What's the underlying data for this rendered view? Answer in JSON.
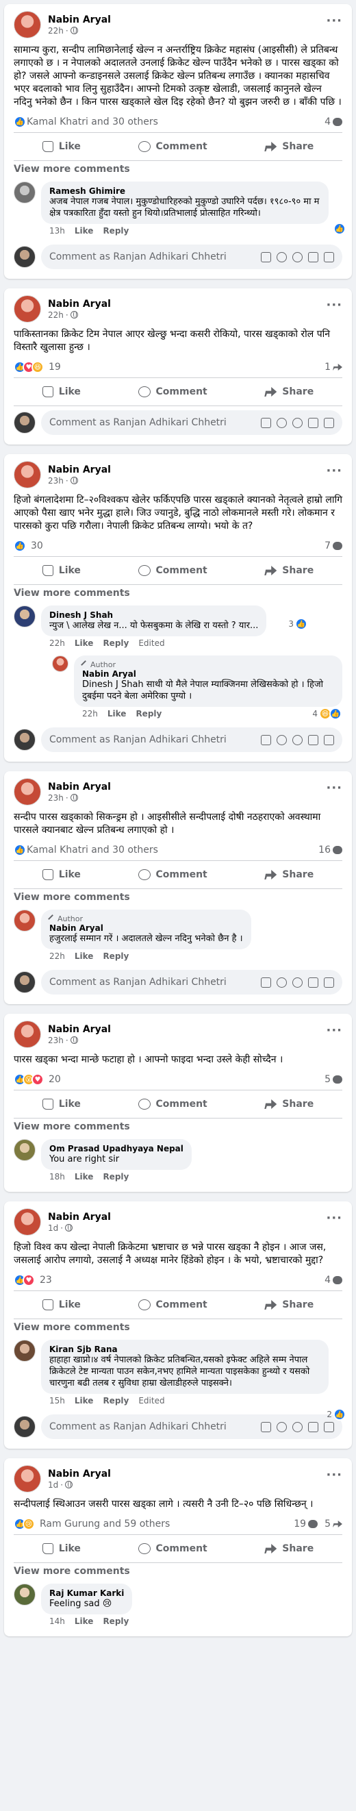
{
  "composer_placeholder": "Comment as Ranjan Adhikari Chhetri",
  "view_more": "View more comments",
  "actions": {
    "like": "Like",
    "comment": "Comment",
    "share": "Share"
  },
  "comment_actions": {
    "like": "Like",
    "reply": "Reply",
    "edited": "Edited"
  },
  "author_label": "Author",
  "posts": [
    {
      "author": "Nabin Aryal",
      "time": "22h",
      "text": "सामान्य कुरा, सन्दीप लामिछानेलाई खेल्न न अन्तर्राष्ट्रिय क्रिकेट महासंघ (आइसीसी) ले प्रतिबन्ध लगाएको छ । न नेपालको अदालतले उनलाई क्रिकेट खेल्न पाउँदैन भनेको छ । पारस खड्का को हो? जसले आफ्नो कन्डाइनसले उसलाई क्रिकेट खेल्न प्रतिबन्ध लगाउँछ । क्यानका महासचिव भएर बदलाको भाव लिनु सुहाउँदैन। आफ्नो टिमको उत्कृष्ट खेलाडी, जसलाई कानुनले खेल्न नदिनु भनेको छैन । किन पारस खड्काले खेल दिइ रहेको छैन? यो बुझन जरुरी छ । बाँकी पछि ।",
      "reactions_text": "Kamal Khatri and 30 others",
      "comments_count": "4",
      "shares_count": "",
      "comments": [
        {
          "name": "Ramesh Ghimire",
          "text": "अजब नेपाल गजब नेपाल। मुकुण्डोधारिहरुको मुकुण्डो उघारिने पर्दछ। १९८०-९० मा म क्षेत्र पत्रकारिता हुँदा यस्तो हुन थियो।प्रतिभालाई प्रोत्साहित गरिन्थ्यो।",
          "time": "13h",
          "likes": ""
        }
      ]
    },
    {
      "author": "Nabin Aryal",
      "time": "22h",
      "text": "पाकिस्तानका क्रिकेट टिम नेपाल आएर खेल्छु भन्दा कसरी रोकियो, पारस खड्काको रोल पनि विस्तारै खुलासा हुन्छ ।",
      "reactions_count": "19",
      "comments_count": "1",
      "comments": []
    },
    {
      "author": "Nabin Aryal",
      "time": "23h",
      "text": "हिजो बंगलादेशमा टि–२०विश्वकप खेलेर फर्किएपछि पारस खड्काले क्यानको नेतृत्वले हाम्रो लागि आएको पैसा खाए भनेर मुद्धा हाले। जिउ ज्यानुडे, बुद्धि नाठो लोकमानले मस्ती गरे। लोकमान र पारसको कुरा पछि गरौला। नेपाली क्रिकेट प्रतिबन्ध लाग्यो। भयो के त?",
      "reactions_count": "30",
      "comments_count": "7",
      "comments": [
        {
          "name": "Dinesh J Shah",
          "text": "न्युज \\ आलेख लेख न... यो फेसबुकमा के लेखि रा यस्तो ? यार...",
          "time": "22h",
          "likes": "3",
          "edited": true
        },
        {
          "name": "Nabin Aryal",
          "is_author": true,
          "is_reply": true,
          "text": "Dinesh J Shah साथी यो मैले नेपाल म्याक्जिनमा लेखिसकेको हो । हिजो दुबईमा पदने बेला अमेरिका पुग्यो ।",
          "time": "22h",
          "likes": "4"
        }
      ]
    },
    {
      "author": "Nabin Aryal",
      "time": "23h",
      "text": "सन्दीप पारस खड्काको सिकन्ड्रम हो । आइसीसीले सन्दीपलाई दोषी नठहराएको अवस्थामा पारसले क्यानबाट खेल्न प्रतिबन्ध लगाएको हो ।",
      "reactions_text": "Kamal Khatri and 30 others",
      "comments_count": "16",
      "comments": [
        {
          "name": "Nabin Aryal",
          "is_author": true,
          "text": "हजुरलाई सम्मान गरें । अदालतले खेल्न नदिनु भनेको छैन है ।",
          "time": "22h",
          "likes": ""
        }
      ]
    },
    {
      "author": "Nabin Aryal",
      "time": "23h",
      "text": "पारस खड्का भन्दा मान्छे फटाहा हो । आफ्नो फाइदा भन्दा उस्ले केही सोच्दैन ।",
      "reactions_count": "20",
      "comments_count": "5",
      "comments": [
        {
          "name": "Om Prasad Upadhyaya Nepal",
          "text": "You are right sir",
          "time": "18h",
          "likes": ""
        }
      ]
    },
    {
      "author": "Nabin Aryal",
      "time": "1d",
      "text": "हिजो विश्व कप खेल्दा नेपाली क्रिकेटमा भ्रष्टाचार छ भन्ने पारस खड्का नै होइन । आज जस, जसलाई आरोप लगायो, उसलाई नै अध्यक्ष मानेर हिंडेको होइन । के भयो, भ्रष्टाचारको मुद्दा?",
      "reactions_count": "23",
      "comments_count": "4",
      "comments": [
        {
          "name": "Kiran Sjb Rana",
          "text": "हाहाहा खाप्नो।४ वर्ष नेपालको क्रिकेट प्रतिबन्धित,यसको इफेक्ट अहिले सम्म नेपाल क्रिकेटले टेष्ट मान्यता पाउन सकेन,नभए हामिले मान्यता पाइसकेका हुन्थ्यो र यसको चारणुना बढी तलब र सुविधा हाम्रा खेलाडीहरुले पाइसक्ने।",
          "time": "15h",
          "likes": "2",
          "edited": true
        }
      ]
    },
    {
      "author": "Nabin Aryal",
      "time": "1d",
      "text": "सन्दीपलाई स्थिआउन जसरी पारस खड्का लागे । त्यसरी नै उनी टि–२० पछि सिधिन्छन् ।",
      "reactions_text": "Ram Gurung and 59 others",
      "comments_count": "19",
      "shares_count": "5",
      "comments": [
        {
          "name": "Raj Kumar Karki",
          "text": "Feeling sad 😢",
          "time": "14h",
          "likes": ""
        }
      ]
    }
  ]
}
